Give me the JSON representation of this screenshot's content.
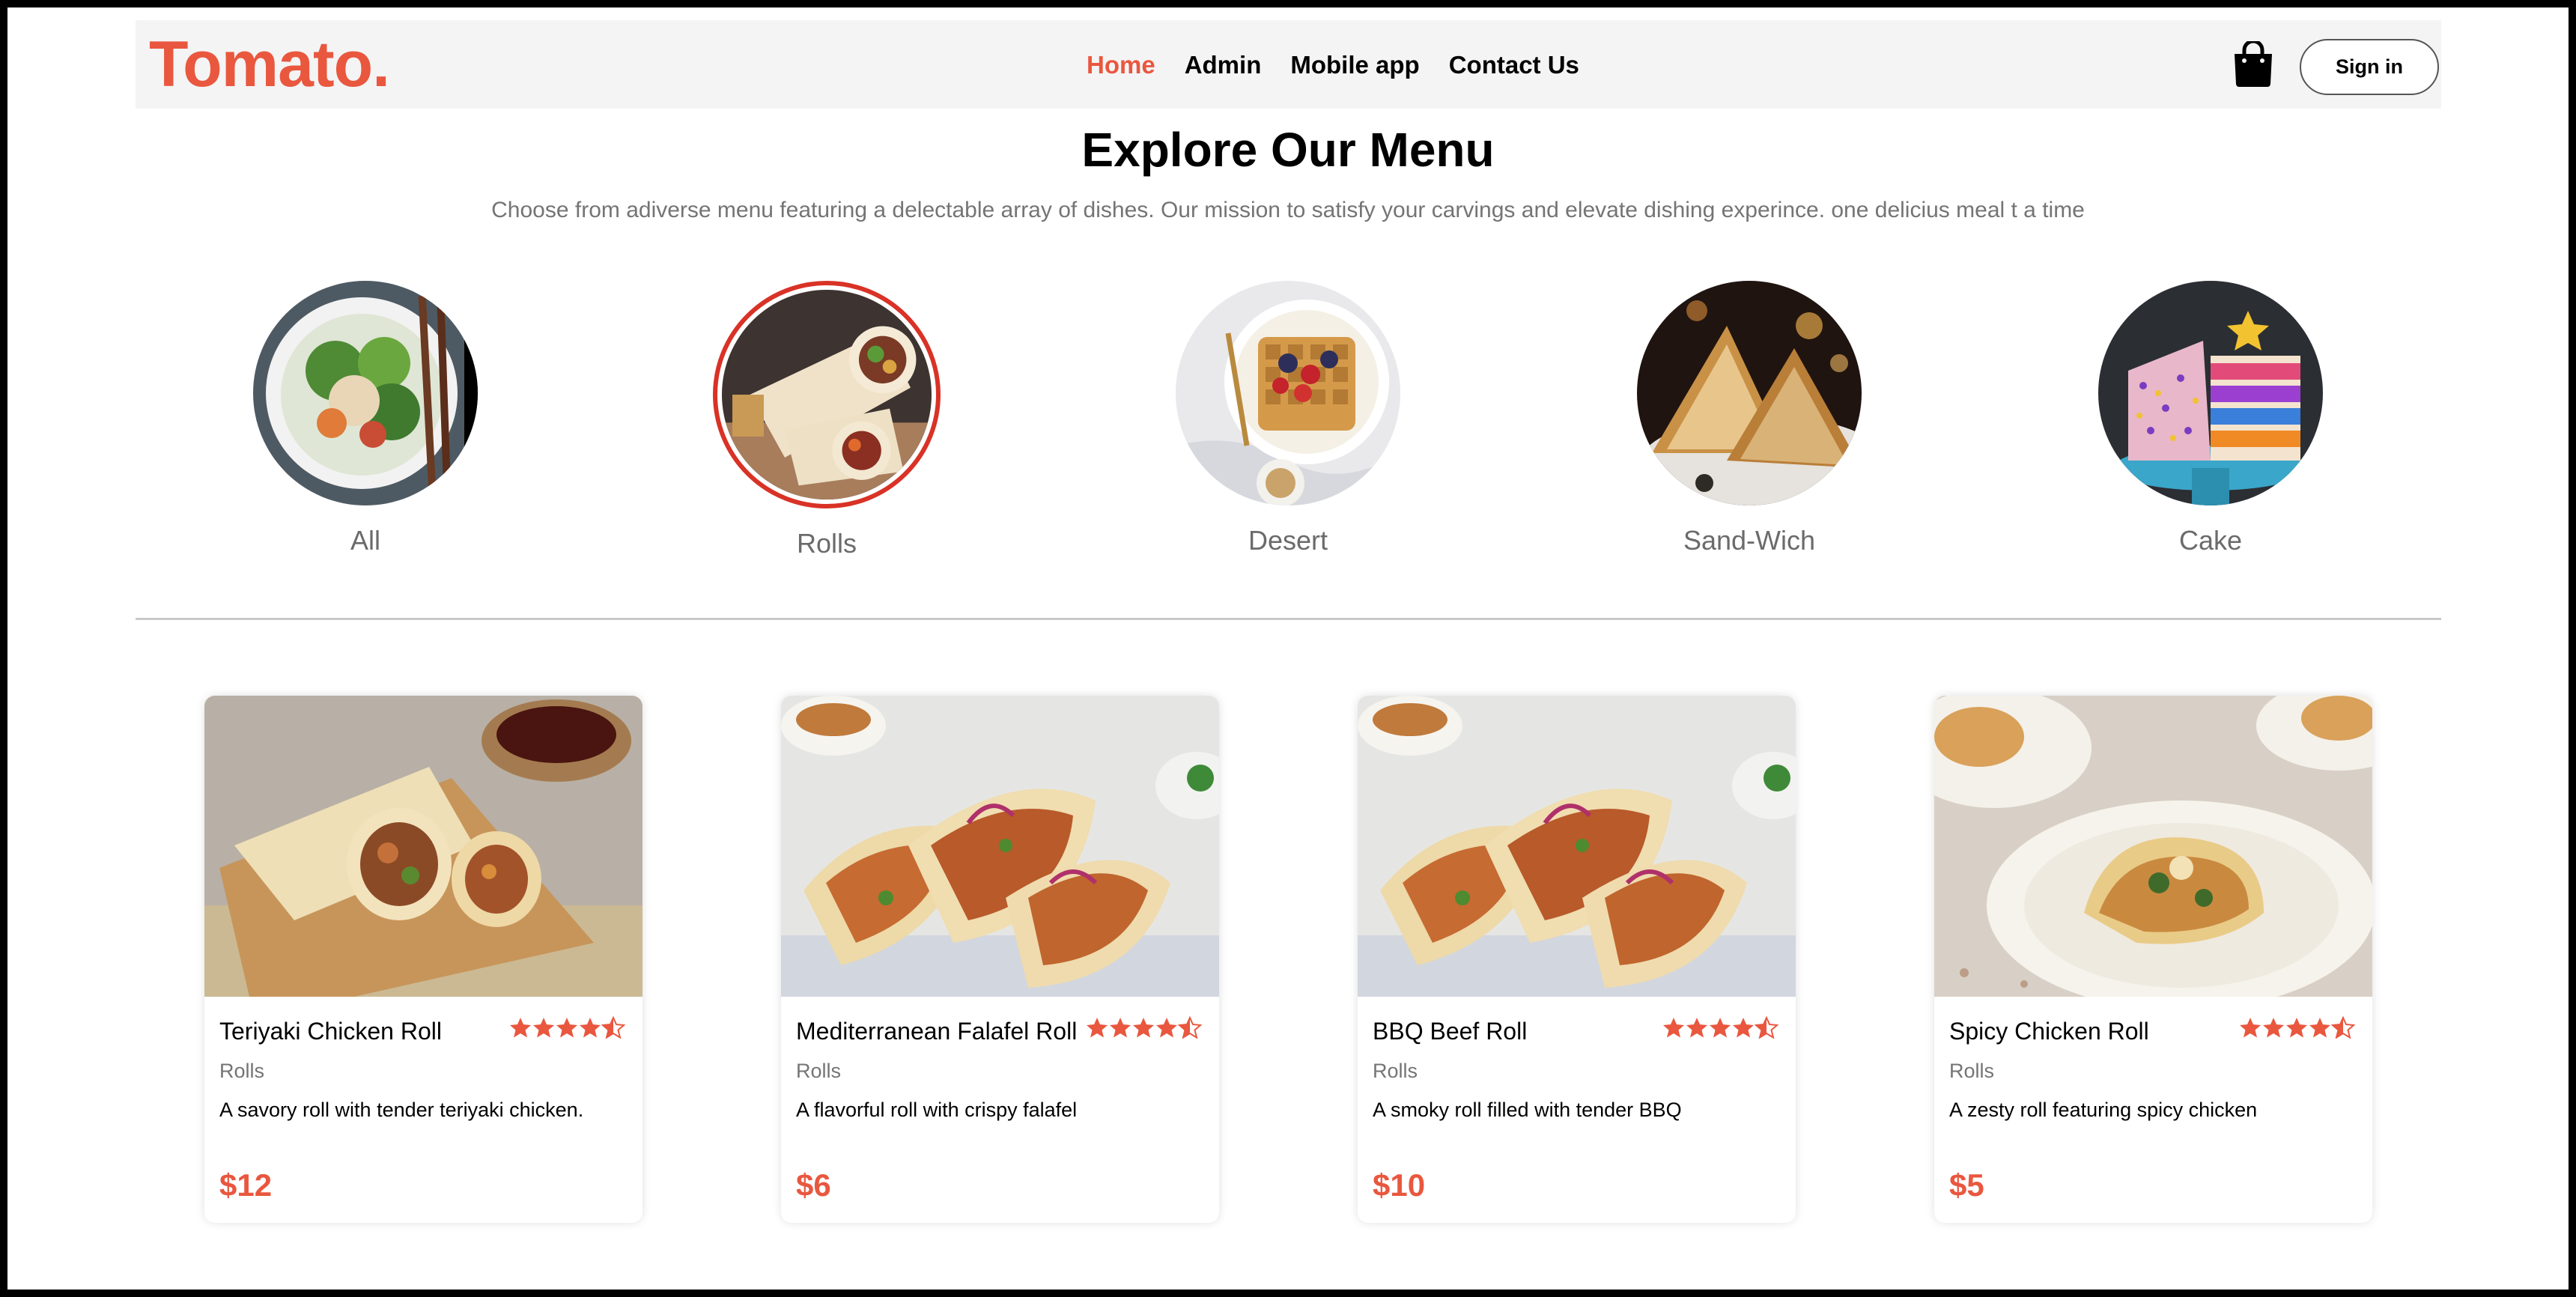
{
  "brand": {
    "logo": "Tomato.",
    "accent": "#e9573f"
  },
  "nav": {
    "items": [
      {
        "label": "Home",
        "active": true
      },
      {
        "label": "Admin",
        "active": false
      },
      {
        "label": "Mobile app",
        "active": false
      },
      {
        "label": "Contact Us",
        "active": false
      }
    ],
    "basket_icon": "shopping-bag-icon",
    "signin_label": "Sign in"
  },
  "hero": {
    "title": "Explore Our Menu",
    "subtitle": "Choose from adiverse menu featuring a delectable array of dishes. Our mission to satisfy your carvings and elevate dishing experince. one delicius meal t a time"
  },
  "categories": [
    {
      "label": "All",
      "selected": false
    },
    {
      "label": "Rolls",
      "selected": true
    },
    {
      "label": "Desert",
      "selected": false
    },
    {
      "label": "Sand-Wich",
      "selected": false
    },
    {
      "label": "Cake",
      "selected": false
    }
  ],
  "products": [
    {
      "name": "Teriyaki Chicken Roll",
      "category": "Rolls",
      "description": "A savory roll with tender teriyaki chicken.",
      "price": "$12",
      "rating": 4.5
    },
    {
      "name": "Mediterranean Falafel Roll",
      "category": "Rolls",
      "description": "A flavorful roll with crispy falafel",
      "price": "$6",
      "rating": 4.5
    },
    {
      "name": "BBQ Beef Roll",
      "category": "Rolls",
      "description": "A smoky roll filled with tender BBQ",
      "price": "$10",
      "rating": 4.5
    },
    {
      "name": "Spicy Chicken Roll",
      "category": "Rolls",
      "description": "A zesty roll featuring spicy chicken",
      "price": "$5",
      "rating": 4.5
    }
  ]
}
